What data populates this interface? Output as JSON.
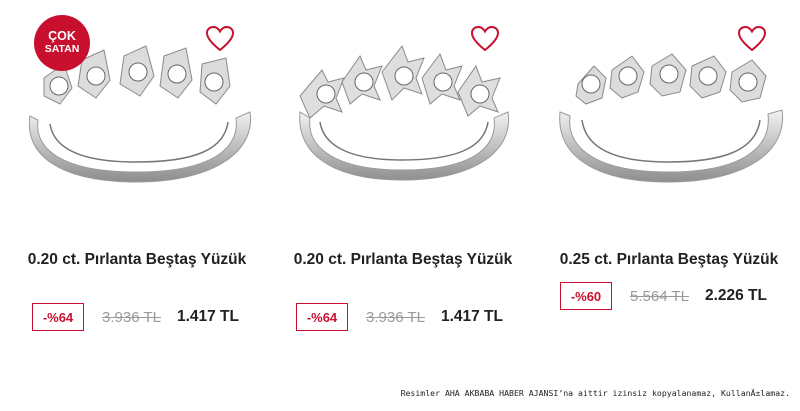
{
  "products": [
    {
      "badge_line1": "ÇOK",
      "badge_line2": "SATAN",
      "title": "0.20 ct. Pırlanta Beştaş Yüzük",
      "discount": "-%64",
      "old_price": "3.936 TL",
      "price": "1.417 TL"
    },
    {
      "title": "0.20 ct. Pırlanta Beştaş Yüzük",
      "discount": "-%64",
      "old_price": "3.936 TL",
      "price": "1.417 TL"
    },
    {
      "title": "0.25 ct. Pırlanta Beştaş Yüzük",
      "discount": "-%60",
      "old_price": "5.564 TL",
      "price": "2.226 TL"
    }
  ],
  "icons": {
    "favorite": "heart-outline-icon"
  },
  "colors": {
    "accent": "#c8102e",
    "old_price": "#9a9a9a",
    "text": "#222222"
  },
  "footer_note": "Resimler AHA AKBABA HABER AJANSI’na aittir izinsiz kopyalanamaz, KullanÄ±lamaz."
}
